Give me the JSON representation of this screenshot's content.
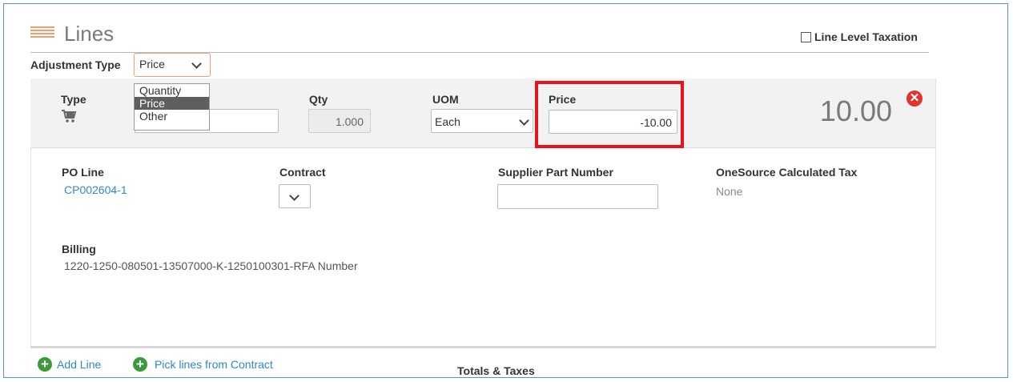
{
  "header": {
    "title": "Lines",
    "line_level_taxation_label": "Line Level Taxation"
  },
  "adjustment": {
    "label": "Adjustment Type",
    "selected": "Price",
    "options": [
      "Quantity",
      "Price",
      "Other"
    ]
  },
  "line": {
    "type_label": "Type",
    "qty_label": "Qty",
    "qty_value": "1.000",
    "uom_label": "UOM",
    "uom_value": "Each",
    "price_label": "Price",
    "price_value": "-10.00",
    "total": "10.00"
  },
  "details": {
    "po_line_label": "PO Line",
    "po_line_value": "CP002604-1",
    "contract_label": "Contract",
    "supplier_part_label": "Supplier Part Number",
    "tax_label": "OneSource Calculated Tax",
    "tax_value": "None",
    "billing_label": "Billing",
    "billing_value": "1220-1250-080501-13507000-K-1250100301-RFA Number"
  },
  "footer": {
    "add_line": "Add Line",
    "pick_lines": "Pick lines from Contract",
    "totals_taxes": "Totals & Taxes"
  },
  "colors": {
    "accent_orange": "#f0a070",
    "link_blue": "#2f8ac6",
    "highlight_red": "#e8141c",
    "add_green": "#3c9a3c"
  }
}
